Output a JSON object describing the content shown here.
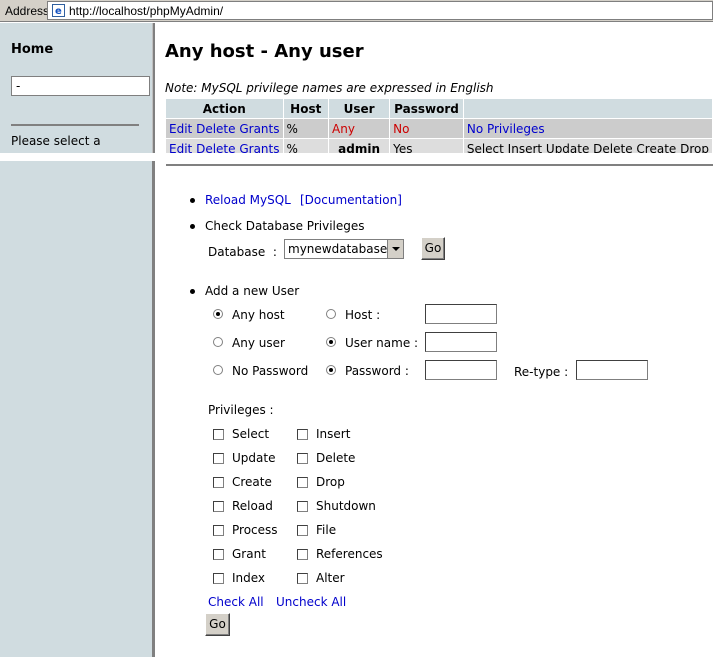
{
  "addressbar": {
    "label": "Address",
    "url": "http://localhost/phpMyAdmin/"
  },
  "left": {
    "home": "Home",
    "db_select_value": "-",
    "hint": "Please select a"
  },
  "main": {
    "title": "Any host - Any user",
    "note": "Note: MySQL privilege names are expressed in English",
    "table": {
      "headers": [
        "Action",
        "Host",
        "User",
        "Password",
        ""
      ],
      "rows": [
        {
          "edit": "Edit",
          "delete": "Delete",
          "grants": "Grants",
          "host": "%",
          "user": "Any",
          "password": "No",
          "privs": "No Privileges"
        },
        {
          "edit": "Edit",
          "delete": "Delete",
          "grants": "Grants",
          "host": "%",
          "user": "admin",
          "password": "Yes",
          "privs": "Select Insert Update Delete Create Drop"
        }
      ]
    },
    "reload": "Reload MySQL",
    "documentation": "[Documentation]",
    "check_db": "Check Database Privileges",
    "database_label": "Database  :",
    "database_value": "mynewdatabase",
    "go": "Go",
    "add_user": "Add a new User",
    "any_host": "Any host",
    "host_label": "Host :",
    "any_user": "Any user",
    "username_label": "User name :",
    "no_password": "No Password",
    "password_label": "Password :",
    "retype_label": "Re-type :",
    "privileges_label": "Privileges :",
    "privileges": [
      [
        "Select",
        "Insert"
      ],
      [
        "Update",
        "Delete"
      ],
      [
        "Create",
        "Drop"
      ],
      [
        "Reload",
        "Shutdown"
      ],
      [
        "Process",
        "File"
      ],
      [
        "Grant",
        "References"
      ],
      [
        "Index",
        "Alter"
      ]
    ],
    "check_all": "Check All",
    "uncheck_all": "Uncheck All"
  }
}
